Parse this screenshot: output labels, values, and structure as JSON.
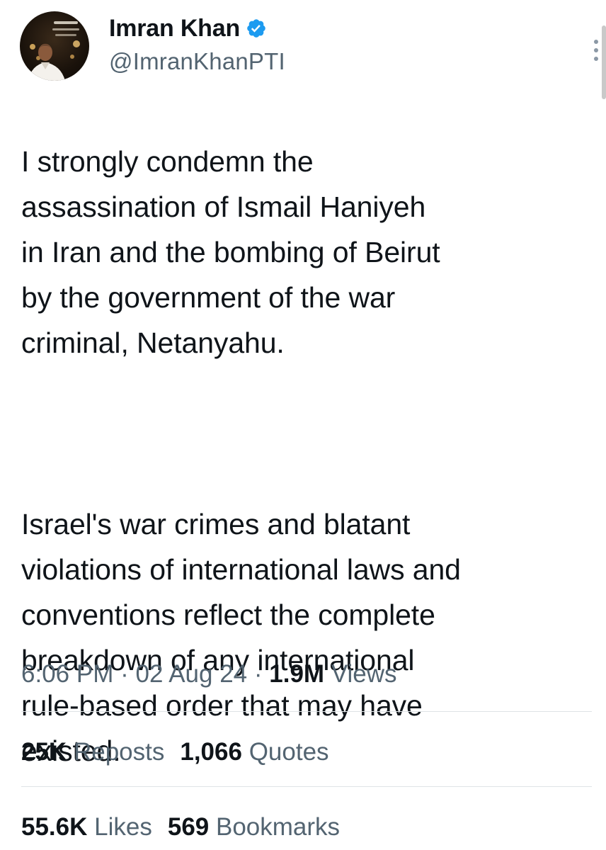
{
  "author": {
    "display_name": "Imran Khan",
    "handle": "@ImranKhanPTI",
    "verified": true,
    "avatar_icon": "profile-photo"
  },
  "tweet": {
    "paragraph_1": "I strongly condemn the\nassassination of Ismail Haniyeh\nin Iran and the bombing of Beirut\nby the government of the war\ncriminal, Netanyahu.",
    "paragraph_2": "Israel's war crimes and blatant\nviolations of international laws and\nconventions reflect the complete\nbreakdown of any international\nrule-based order that may have\nexisted."
  },
  "meta": {
    "time": "6:06 PM",
    "separator": "·",
    "date": "02 Aug 24",
    "views_count": "1.9M",
    "views_label": "Views"
  },
  "stats": {
    "reposts_count": "25K",
    "reposts_label": "Reposts",
    "quotes_count": "1,066",
    "quotes_label": "Quotes",
    "likes_count": "55.6K",
    "likes_label": "Likes",
    "bookmarks_count": "569",
    "bookmarks_label": "Bookmarks"
  },
  "colors": {
    "text_primary": "#0f1419",
    "text_secondary": "#536471",
    "verified_blue": "#1d9bf0",
    "divider": "#dfe3e6"
  }
}
